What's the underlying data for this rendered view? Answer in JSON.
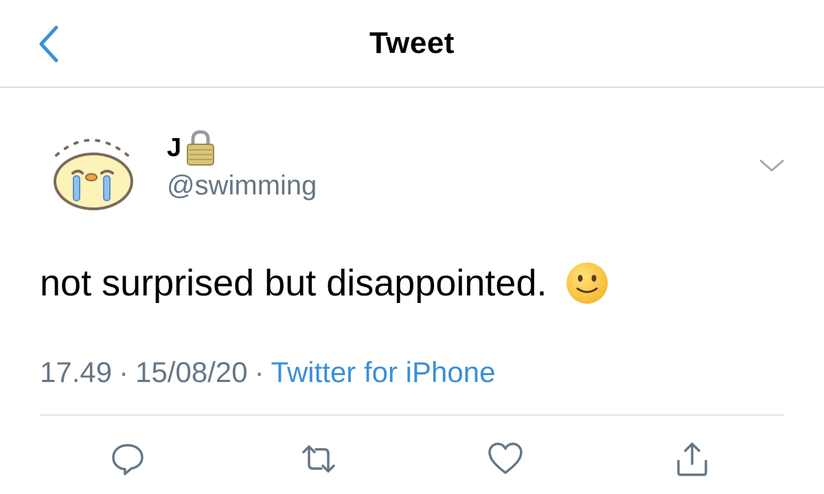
{
  "header": {
    "title": "Tweet",
    "back_icon": "chevron-left-icon",
    "accent_color": "#3a8fd8"
  },
  "author": {
    "display_name": "J",
    "name_badge_icon": "padlock-icon",
    "handle": "@swimming",
    "avatar_icon": "crying-chick-icon",
    "menu_icon": "chevron-down-icon"
  },
  "tweet": {
    "text": "not surprised but disappointed.",
    "emoji_icon": "slightly-smiling-face-icon"
  },
  "meta": {
    "time": "17.49",
    "separator": "·",
    "date": "15/08/20",
    "source": "Twitter for iPhone",
    "source_color": "#3a8fd8",
    "text_color": "#657786"
  },
  "actions": [
    {
      "name": "reply",
      "icon": "speech-bubble-icon"
    },
    {
      "name": "retweet",
      "icon": "retweet-icon"
    },
    {
      "name": "like",
      "icon": "heart-icon"
    },
    {
      "name": "share",
      "icon": "share-icon"
    }
  ]
}
